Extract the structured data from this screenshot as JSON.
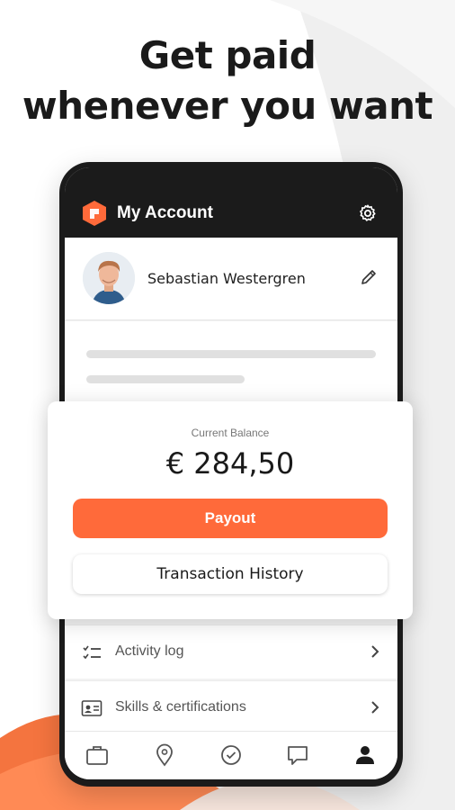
{
  "headline": {
    "line1": "Get paid",
    "line2": "whenever you want"
  },
  "app": {
    "title": "My Account",
    "accent_color": "#ff6a3a"
  },
  "profile": {
    "name": "Sebastian Westergren"
  },
  "balance": {
    "label": "Current Balance",
    "amount": "€ 284,50",
    "payout_label": "Payout",
    "history_label": "Transaction History"
  },
  "menu": {
    "items": [
      {
        "label": "Activity log",
        "icon": "checklist-icon"
      },
      {
        "label": "Skills & certifications",
        "icon": "id-card-icon"
      }
    ]
  },
  "nav": {
    "items": [
      {
        "icon": "briefcase-icon"
      },
      {
        "icon": "location-pin-icon"
      },
      {
        "icon": "check-circle-icon"
      },
      {
        "icon": "chat-bubble-icon"
      },
      {
        "icon": "user-icon",
        "active": true
      }
    ]
  }
}
